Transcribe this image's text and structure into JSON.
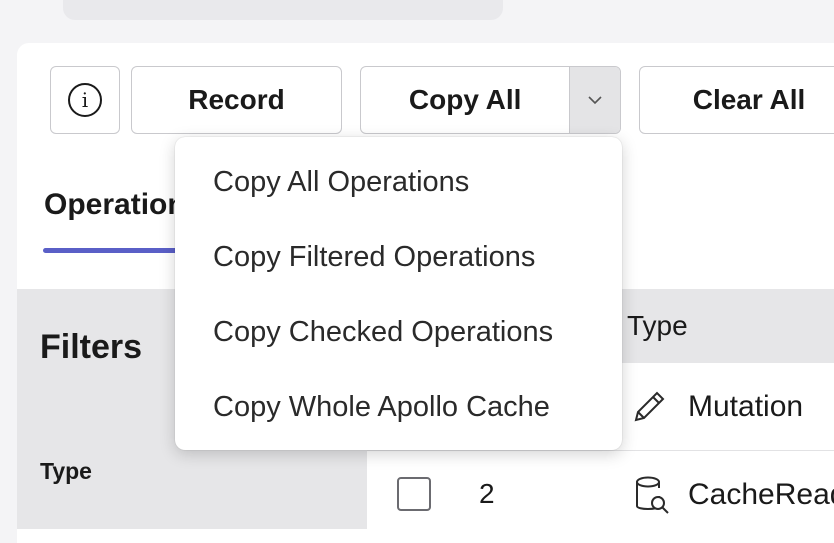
{
  "toolbar": {
    "info_glyph": "i",
    "record_label": "Record",
    "copy_all_label": "Copy All",
    "clear_all_label": "Clear All"
  },
  "tabs": {
    "operations_label": "Operations"
  },
  "copy_menu": {
    "items": [
      {
        "label": "Copy All Operations"
      },
      {
        "label": "Copy Filtered Operations"
      },
      {
        "label": "Copy Checked Operations"
      },
      {
        "label": "Copy Whole Apollo Cache"
      }
    ]
  },
  "filters": {
    "title": "Filters",
    "type_label": "Type"
  },
  "table": {
    "type_header": "Type",
    "rows": [
      {
        "number": "",
        "type": "Mutation",
        "icon": "pencil-icon"
      },
      {
        "number": "2",
        "type": "CacheRead",
        "icon": "cache-read-icon"
      }
    ]
  },
  "colors": {
    "accent": "#5a5fc7",
    "background": "#f4f4f6",
    "header_bg": "#e6e6e8"
  }
}
